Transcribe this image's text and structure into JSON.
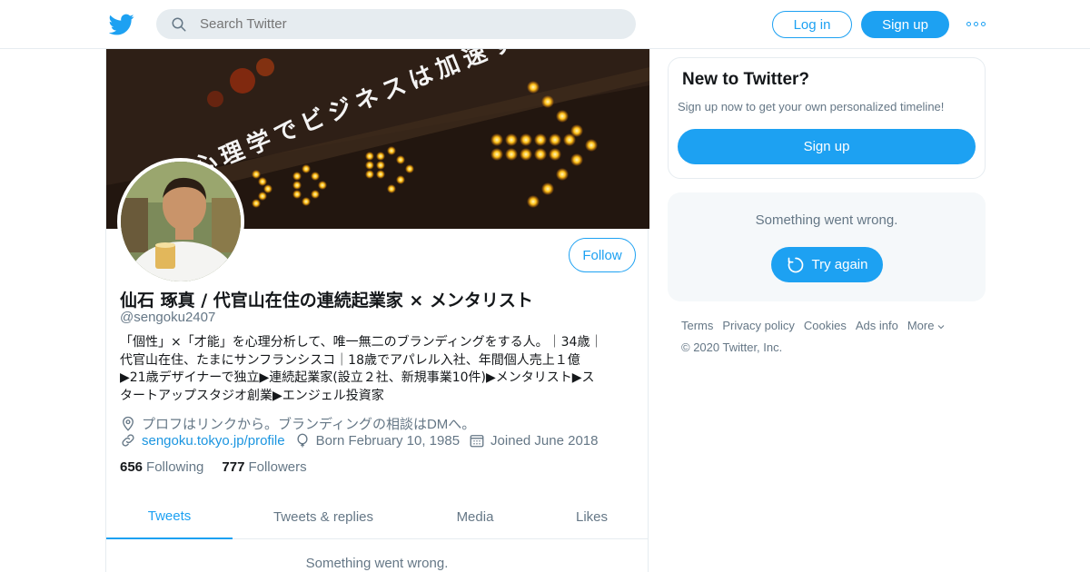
{
  "header": {
    "search_placeholder": "Search Twitter",
    "login_label": "Log in",
    "signup_label": "Sign up"
  },
  "banner": {
    "text": "心理学でビジネスは加速する"
  },
  "profile": {
    "follow_label": "Follow",
    "name": "仙石 琢真 / 代官山在住の連続起業家 × メンタリスト",
    "handle": "@sengoku2407",
    "bio_lines": [
      "「個性」×「才能」を心理分析して、唯一無二のブランディングをする人。｜34歳｜",
      "代官山在住、たまにサンフランシスコ｜18歳でアパレル入社、年間個人売上１億",
      "▶21歳デザイナーで独立▶連続起業家(設立２社、新規事業10件)▶メンタリスト▶ス",
      "タートアップスタジオ創業▶エンジェル投資家"
    ],
    "location": "プロフはリンクから。ブランディングの相談はDMへ。",
    "url": "sengoku.tokyo.jp/profile",
    "birth": "Born February 10, 1985",
    "joined": "Joined June 2018",
    "following_count": "656",
    "following_label": "Following",
    "followers_count": "777",
    "followers_label": "Followers"
  },
  "tabs": [
    {
      "label": "Tweets",
      "active": true
    },
    {
      "label": "Tweets & replies",
      "active": false
    },
    {
      "label": "Media",
      "active": false
    },
    {
      "label": "Likes",
      "active": false
    }
  ],
  "main_error": "Something went wrong.",
  "sidebar": {
    "new_title": "New to Twitter?",
    "new_desc": "Sign up now to get your own personalized timeline!",
    "signup_label": "Sign up",
    "error_msg": "Something went wrong.",
    "try_again_label": "Try again"
  },
  "footer": {
    "links": [
      "Terms",
      "Privacy policy",
      "Cookies",
      "Ads info",
      "More"
    ],
    "copyright": "© 2020 Twitter, Inc."
  },
  "colors": {
    "accent": "#1da1f2",
    "secondary_text": "#657786",
    "border": "#e6ecf0"
  }
}
